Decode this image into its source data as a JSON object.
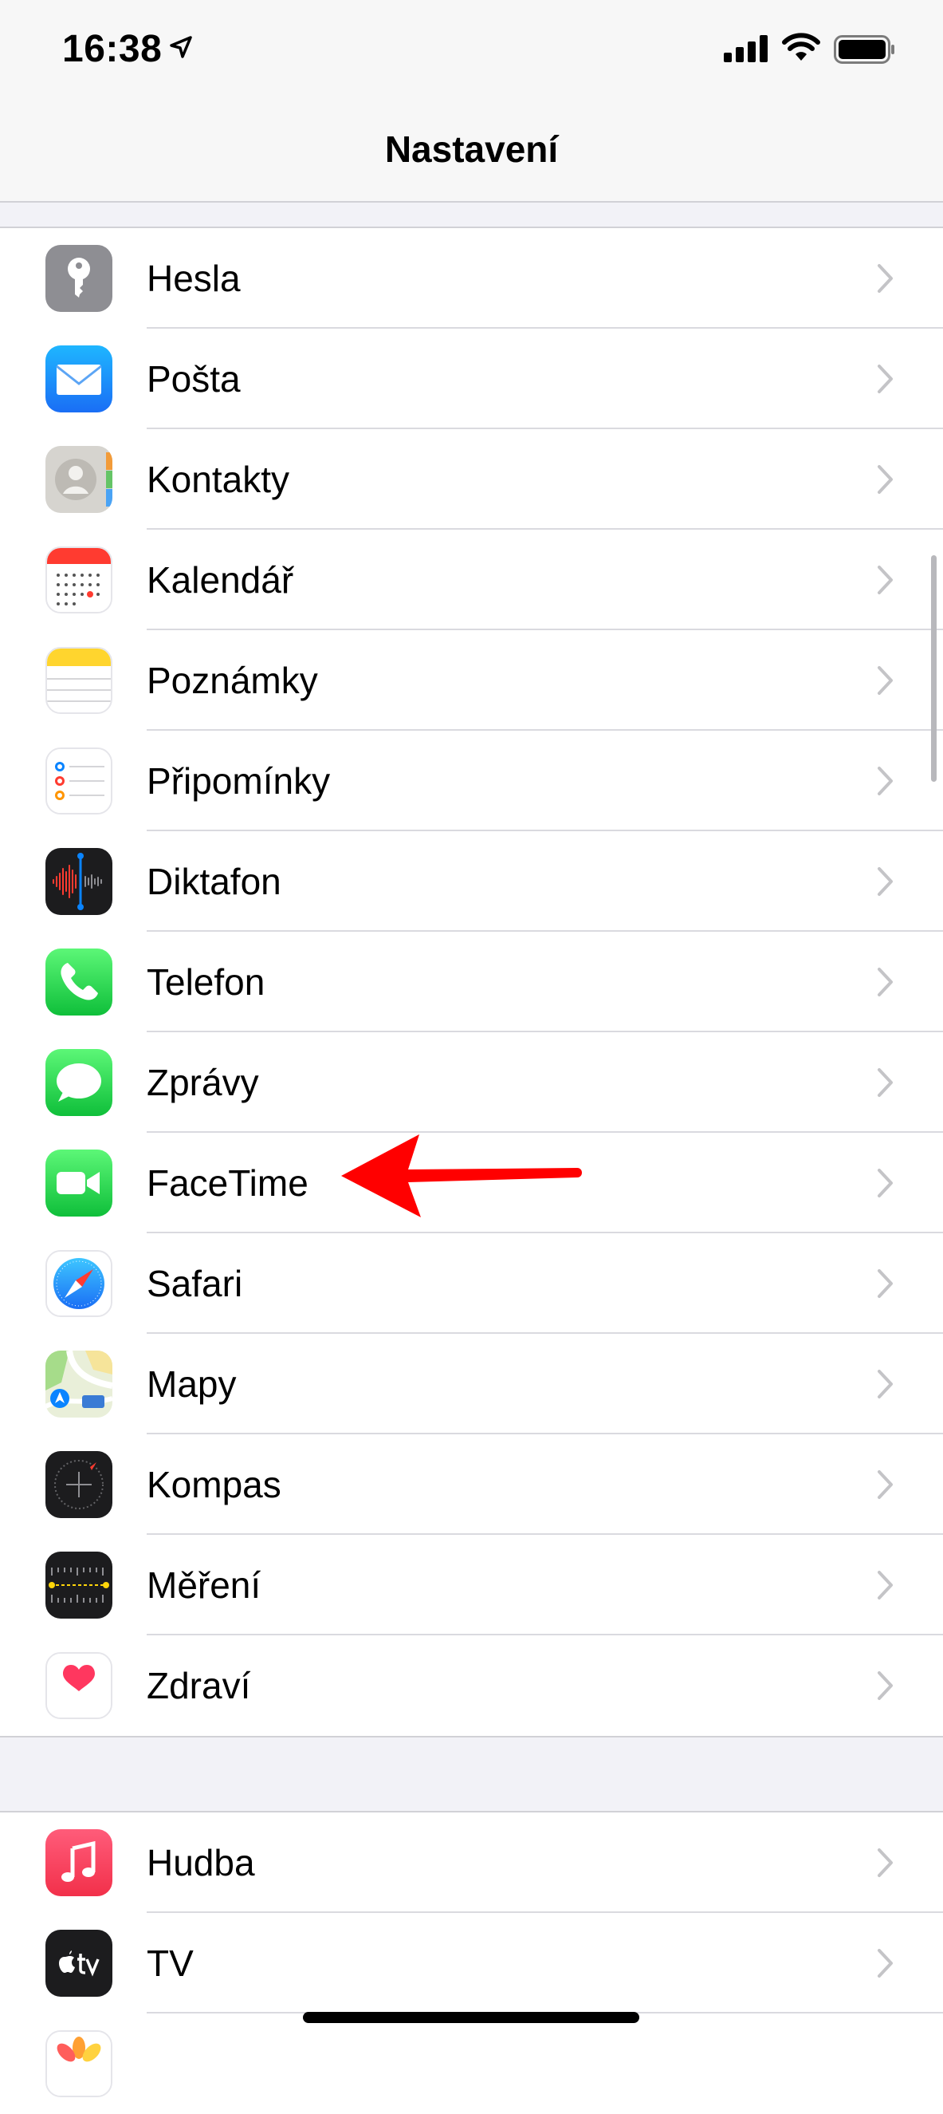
{
  "status_bar": {
    "time": "16:38"
  },
  "nav": {
    "title": "Nastavení"
  },
  "group1": [
    {
      "label": "Hesla",
      "icon": "key-icon"
    },
    {
      "label": "Pošta",
      "icon": "mail-icon"
    },
    {
      "label": "Kontakty",
      "icon": "contacts-icon"
    },
    {
      "label": "Kalendář",
      "icon": "calendar-icon"
    },
    {
      "label": "Poznámky",
      "icon": "notes-icon"
    },
    {
      "label": "Připomínky",
      "icon": "reminders-icon"
    },
    {
      "label": "Diktafon",
      "icon": "voice-memos-icon"
    },
    {
      "label": "Telefon",
      "icon": "phone-icon"
    },
    {
      "label": "Zprávy",
      "icon": "messages-icon"
    },
    {
      "label": "FaceTime",
      "icon": "facetime-icon"
    },
    {
      "label": "Safari",
      "icon": "safari-compass-icon"
    },
    {
      "label": "Mapy",
      "icon": "maps-icon"
    },
    {
      "label": "Kompas",
      "icon": "compass-icon"
    },
    {
      "label": "Měření",
      "icon": "measure-icon"
    },
    {
      "label": "Zdraví",
      "icon": "health-heart-icon"
    }
  ],
  "group2": [
    {
      "label": "Hudba",
      "icon": "music-note-icon"
    },
    {
      "label": "TV",
      "icon": "apple-tv-icon"
    }
  ],
  "annotation": {
    "icon": "red-arrow-icon",
    "color": "#ff0000"
  }
}
